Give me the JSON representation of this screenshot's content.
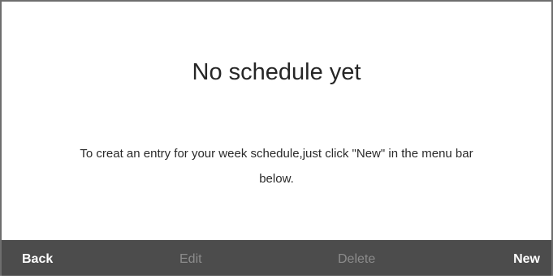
{
  "empty_state": {
    "title": "No schedule yet",
    "message_line1": "To creat an entry for your week schedule,just click \"New\" in the menu bar",
    "message_line2": "below."
  },
  "menu_bar": {
    "back": "Back",
    "edit": "Edit",
    "delete": "Delete",
    "new": "New"
  },
  "colors": {
    "menu_bar_bg": "#4c4c4c",
    "active_text": "#ffffff",
    "disabled_text": "#8c8c8c",
    "frame_border": "#6e6e6e"
  }
}
